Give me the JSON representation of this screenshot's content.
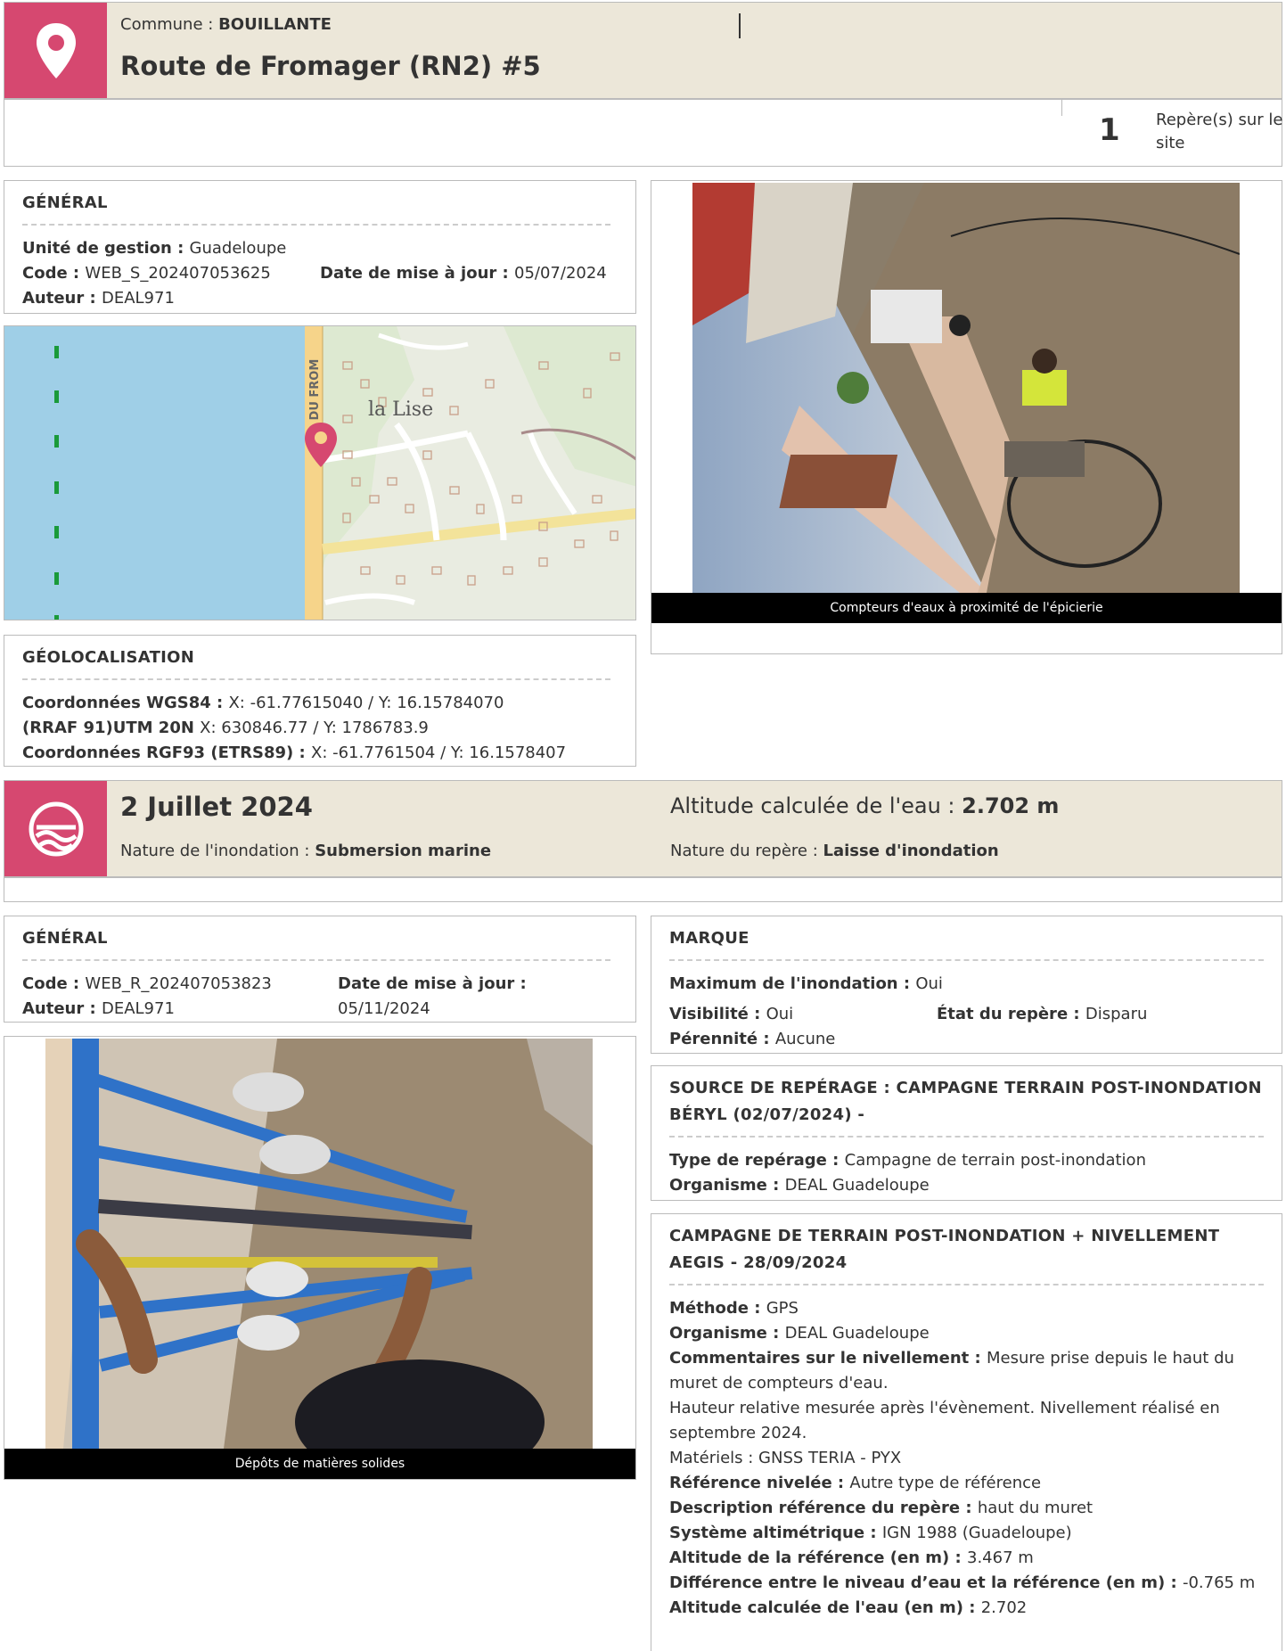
{
  "site": {
    "commune_label": "Commune : ",
    "commune": "BOUILLANTE",
    "title": "Route de Fromager (RN2) #5",
    "count": "1",
    "count_label": "Repère(s) sur le site"
  },
  "general": {
    "title": "GÉNÉRAL",
    "unite_label": "Unité de gestion : ",
    "unite": "Guadeloupe",
    "code_label": "Code : ",
    "code": "WEB_S_202407053625",
    "date_label": "Date de mise à jour : ",
    "date": "05/07/2024",
    "auteur_label": "Auteur : ",
    "auteur": "DEAL971"
  },
  "map": {
    "place_label": "la Lise",
    "road_label": "R DU FROM"
  },
  "photo1": {
    "caption": "Compteurs d'eaux à proximité de l'épicierie"
  },
  "geo": {
    "title": "GÉOLOCALISATION",
    "wgs_label": "Coordonnées WGS84 : ",
    "wgs": "X: -61.77615040 / Y: 16.15784070",
    "utm_label": "(RRAF 91)UTM 20N ",
    "utm": "X: 630846.77 / Y: 1786783.9",
    "rgf_label": "Coordonnées RGF93 (ETRS89) : ",
    "rgf": "X: -61.7761504 / Y: 16.1578407"
  },
  "event": {
    "date": "2 Juillet 2024",
    "nature_label": "Nature de l'inondation : ",
    "nature": "Submersion marine",
    "altitude_label": "Altitude calculée de l'eau : ",
    "altitude": "2.702 m",
    "repere_label": "Nature du repère : ",
    "repere": "Laisse d'inondation"
  },
  "general2": {
    "title": "GÉNÉRAL",
    "code_label": "Code : ",
    "code": "WEB_R_202407053823",
    "date_label": "Date de mise à jour :",
    "date": "05/11/2024",
    "auteur_label": "Auteur : ",
    "auteur": "DEAL971"
  },
  "photo2": {
    "caption": "Dépôts de matières solides"
  },
  "marque": {
    "title": "MARQUE",
    "max_label": "Maximum de l'inondation : ",
    "max": "Oui",
    "vis_label": "Visibilité : ",
    "vis": "Oui",
    "etat_label": "État du repère : ",
    "etat": "Disparu",
    "per_label": "Pérennité : ",
    "per": "Aucune"
  },
  "source": {
    "title": "SOURCE DE REPÉRAGE : CAMPAGNE TERRAIN POST-INONDATION BÉRYL (02/07/2024) -",
    "type_label": "Type de repérage : ",
    "type": "Campagne de terrain post-inondation",
    "org_label": "Organisme : ",
    "org": "DEAL Guadeloupe"
  },
  "campagne": {
    "title": "CAMPAGNE DE TERRAIN POST-INONDATION + NIVELLEMENT AEGIS - 28/09/2024",
    "methode_label": "Méthode : ",
    "methode": "GPS",
    "org_label": "Organisme : ",
    "org": "DEAL Guadeloupe",
    "comment_label": "Commentaires sur le nivellement : ",
    "comment1": "Mesure prise depuis le haut du muret de compteurs d'eau.",
    "comment2": "Hauteur relative mesurée après l'évènement. Nivellement réalisé en septembre 2024.",
    "comment3": "Matériels : GNSS TERIA - PYX",
    "ref_label": "Référence nivelée : ",
    "ref": "Autre type de référence",
    "desc_label": "Description référence du repère : ",
    "desc": "haut du muret",
    "sys_label": "Système altimétrique : ",
    "sys": "IGN 1988 (Guadeloupe)",
    "altref_label": "Altitude de la référence (en m) : ",
    "altref": "3.467 m",
    "diff_label": "Différence entre le niveau d’eau et la référence (en m) : ",
    "diff": "-0.765 m",
    "altcalc_label": "Altitude calculée de l'eau (en m) : ",
    "altcalc": "2.702"
  }
}
